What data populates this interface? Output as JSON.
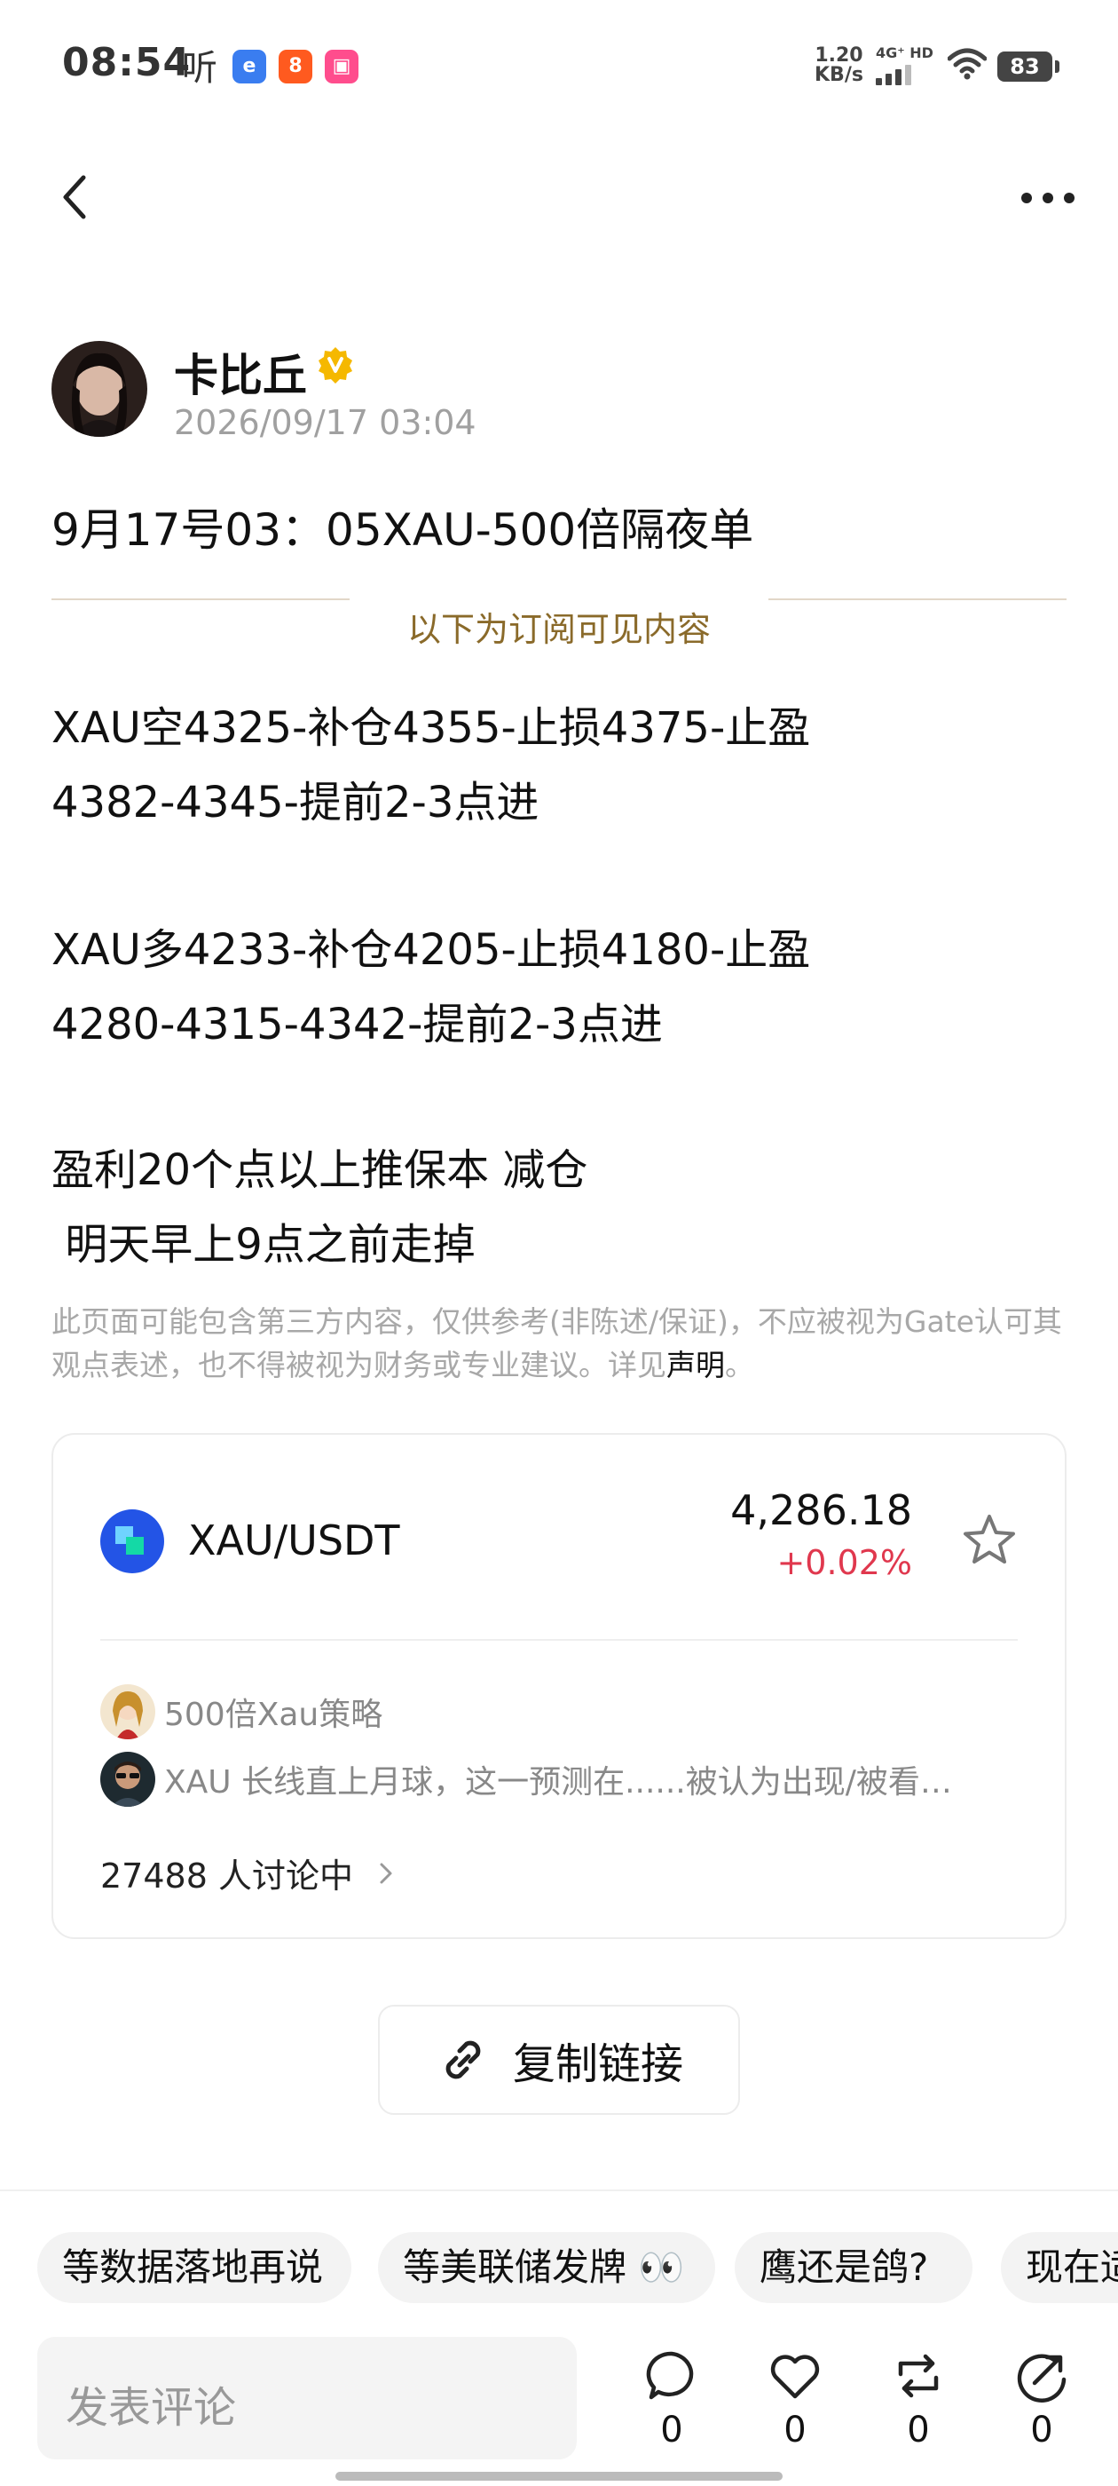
{
  "status_bar": {
    "time": "08:54",
    "ting": "听",
    "speed_value": "1.20",
    "speed_unit": "KB/s",
    "network": "4G⁺ HD",
    "battery": "83"
  },
  "author": {
    "name": "卡比丘",
    "time": "2026/09/17 03:04"
  },
  "post": {
    "title": "9月17号03：05XAU-500倍隔夜单",
    "subscribe_label": "以下为订阅可见内容",
    "lines": [
      "XAU空4325-补仓4355-止损4375-止盈",
      "4382-4345-提前2-3点进",
      "XAU多4233-补仓4205-止损4180-止盈",
      "4280-4315-4342-提前2-3点进",
      "盈利20个点以上推保本 减仓",
      " 明天早上9点之前走掉"
    ],
    "disclaimer": "此页面可能包含第三方内容，仅供参考(非陈述/保证)，不应被视为Gate认可其观点表述，也不得被视为财务或专业建议。详见",
    "disclaimer_link": "声明",
    "disclaimer_end": "。"
  },
  "market": {
    "pair": "XAU/USDT",
    "price": "4,286.18",
    "change": "+0.02%",
    "discussions": [
      "500倍Xau策略",
      "XAU 长线直上月球，这一预测在......被认为出现/被看…"
    ],
    "discussing": "27488 人讨论中"
  },
  "copy_link": "复制链接",
  "chips": [
    "等数据落地再说",
    "等美联储发牌 👀",
    "鹰还是鸽?",
    "现在适"
  ],
  "comment_placeholder": "发表评论",
  "actions": {
    "comments": "0",
    "likes": "0",
    "reposts": "0",
    "shares": "0"
  },
  "colors": {
    "price_up": "#e0384e",
    "subscribe_text": "#8a6a2a",
    "verified": "#f5b800",
    "coin": "#2354e6"
  }
}
